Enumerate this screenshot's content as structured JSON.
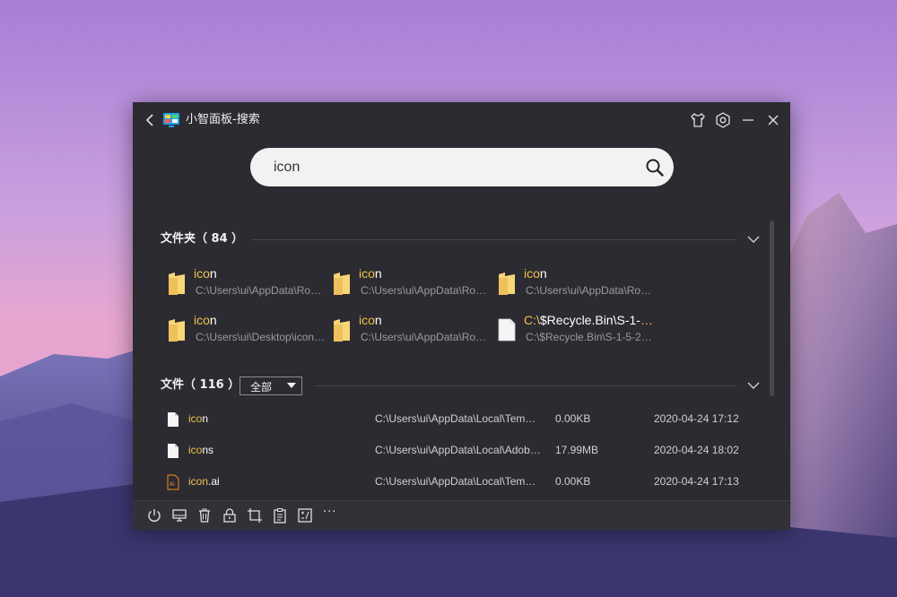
{
  "window": {
    "title": "小智面板-搜索"
  },
  "search": {
    "value": "icon",
    "placeholder": ""
  },
  "folders": {
    "header": "文件夹（ 84 ）",
    "items": [
      {
        "name_hl": "ico",
        "name_rest": "n",
        "path": "C:\\Users\\ui\\AppData\\Roaming\\..."
      },
      {
        "name_hl": "ico",
        "name_rest": "n",
        "path": "C:\\Users\\ui\\AppData\\Roaming\\..."
      },
      {
        "name_hl": "ico",
        "name_rest": "n",
        "path": "C:\\Users\\ui\\AppData\\Roaming\\..."
      },
      {
        "name_hl": "ico",
        "name_rest": "n",
        "path": "C:\\Users\\ui\\Desktop\\icon\\..."
      },
      {
        "name_hl": "ico",
        "name_rest": "n",
        "path": "C:\\Users\\ui\\AppData\\Roaming\\..."
      },
      {
        "name_hl": "C:\\",
        "name_rest": "$Recycle.Bin\\S-1-5-21...",
        "path": "C:\\$Recycle.Bin\\S-1-5-21-..."
      }
    ]
  },
  "files": {
    "header": "文件（ 116 ）",
    "filter_value": "全部",
    "rows": [
      {
        "name_hl": "ico",
        "name_rest": "n",
        "path": "C:\\Users\\ui\\AppData\\Local\\Temp\\...",
        "size": "0.00KB",
        "date": "2020-04-24 17:12",
        "type": "file"
      },
      {
        "name_hl": "ico",
        "name_rest": "ns",
        "path": "C:\\Users\\ui\\AppData\\Local\\Adobe\\...",
        "size": "17.99MB",
        "date": "2020-04-24 18:02",
        "type": "file"
      },
      {
        "name_hl": "icon",
        "name_rest": ".ai",
        "path": "C:\\Users\\ui\\AppData\\Local\\Temp\\...",
        "size": "0.00KB",
        "date": "2020-04-24 17:13",
        "type": "ai"
      }
    ]
  },
  "bottombar": {
    "more_label": "···"
  },
  "colors": {
    "window_bg": "#2c2b31",
    "highlight": "#f0c24c",
    "folder": "#f2c94c"
  }
}
